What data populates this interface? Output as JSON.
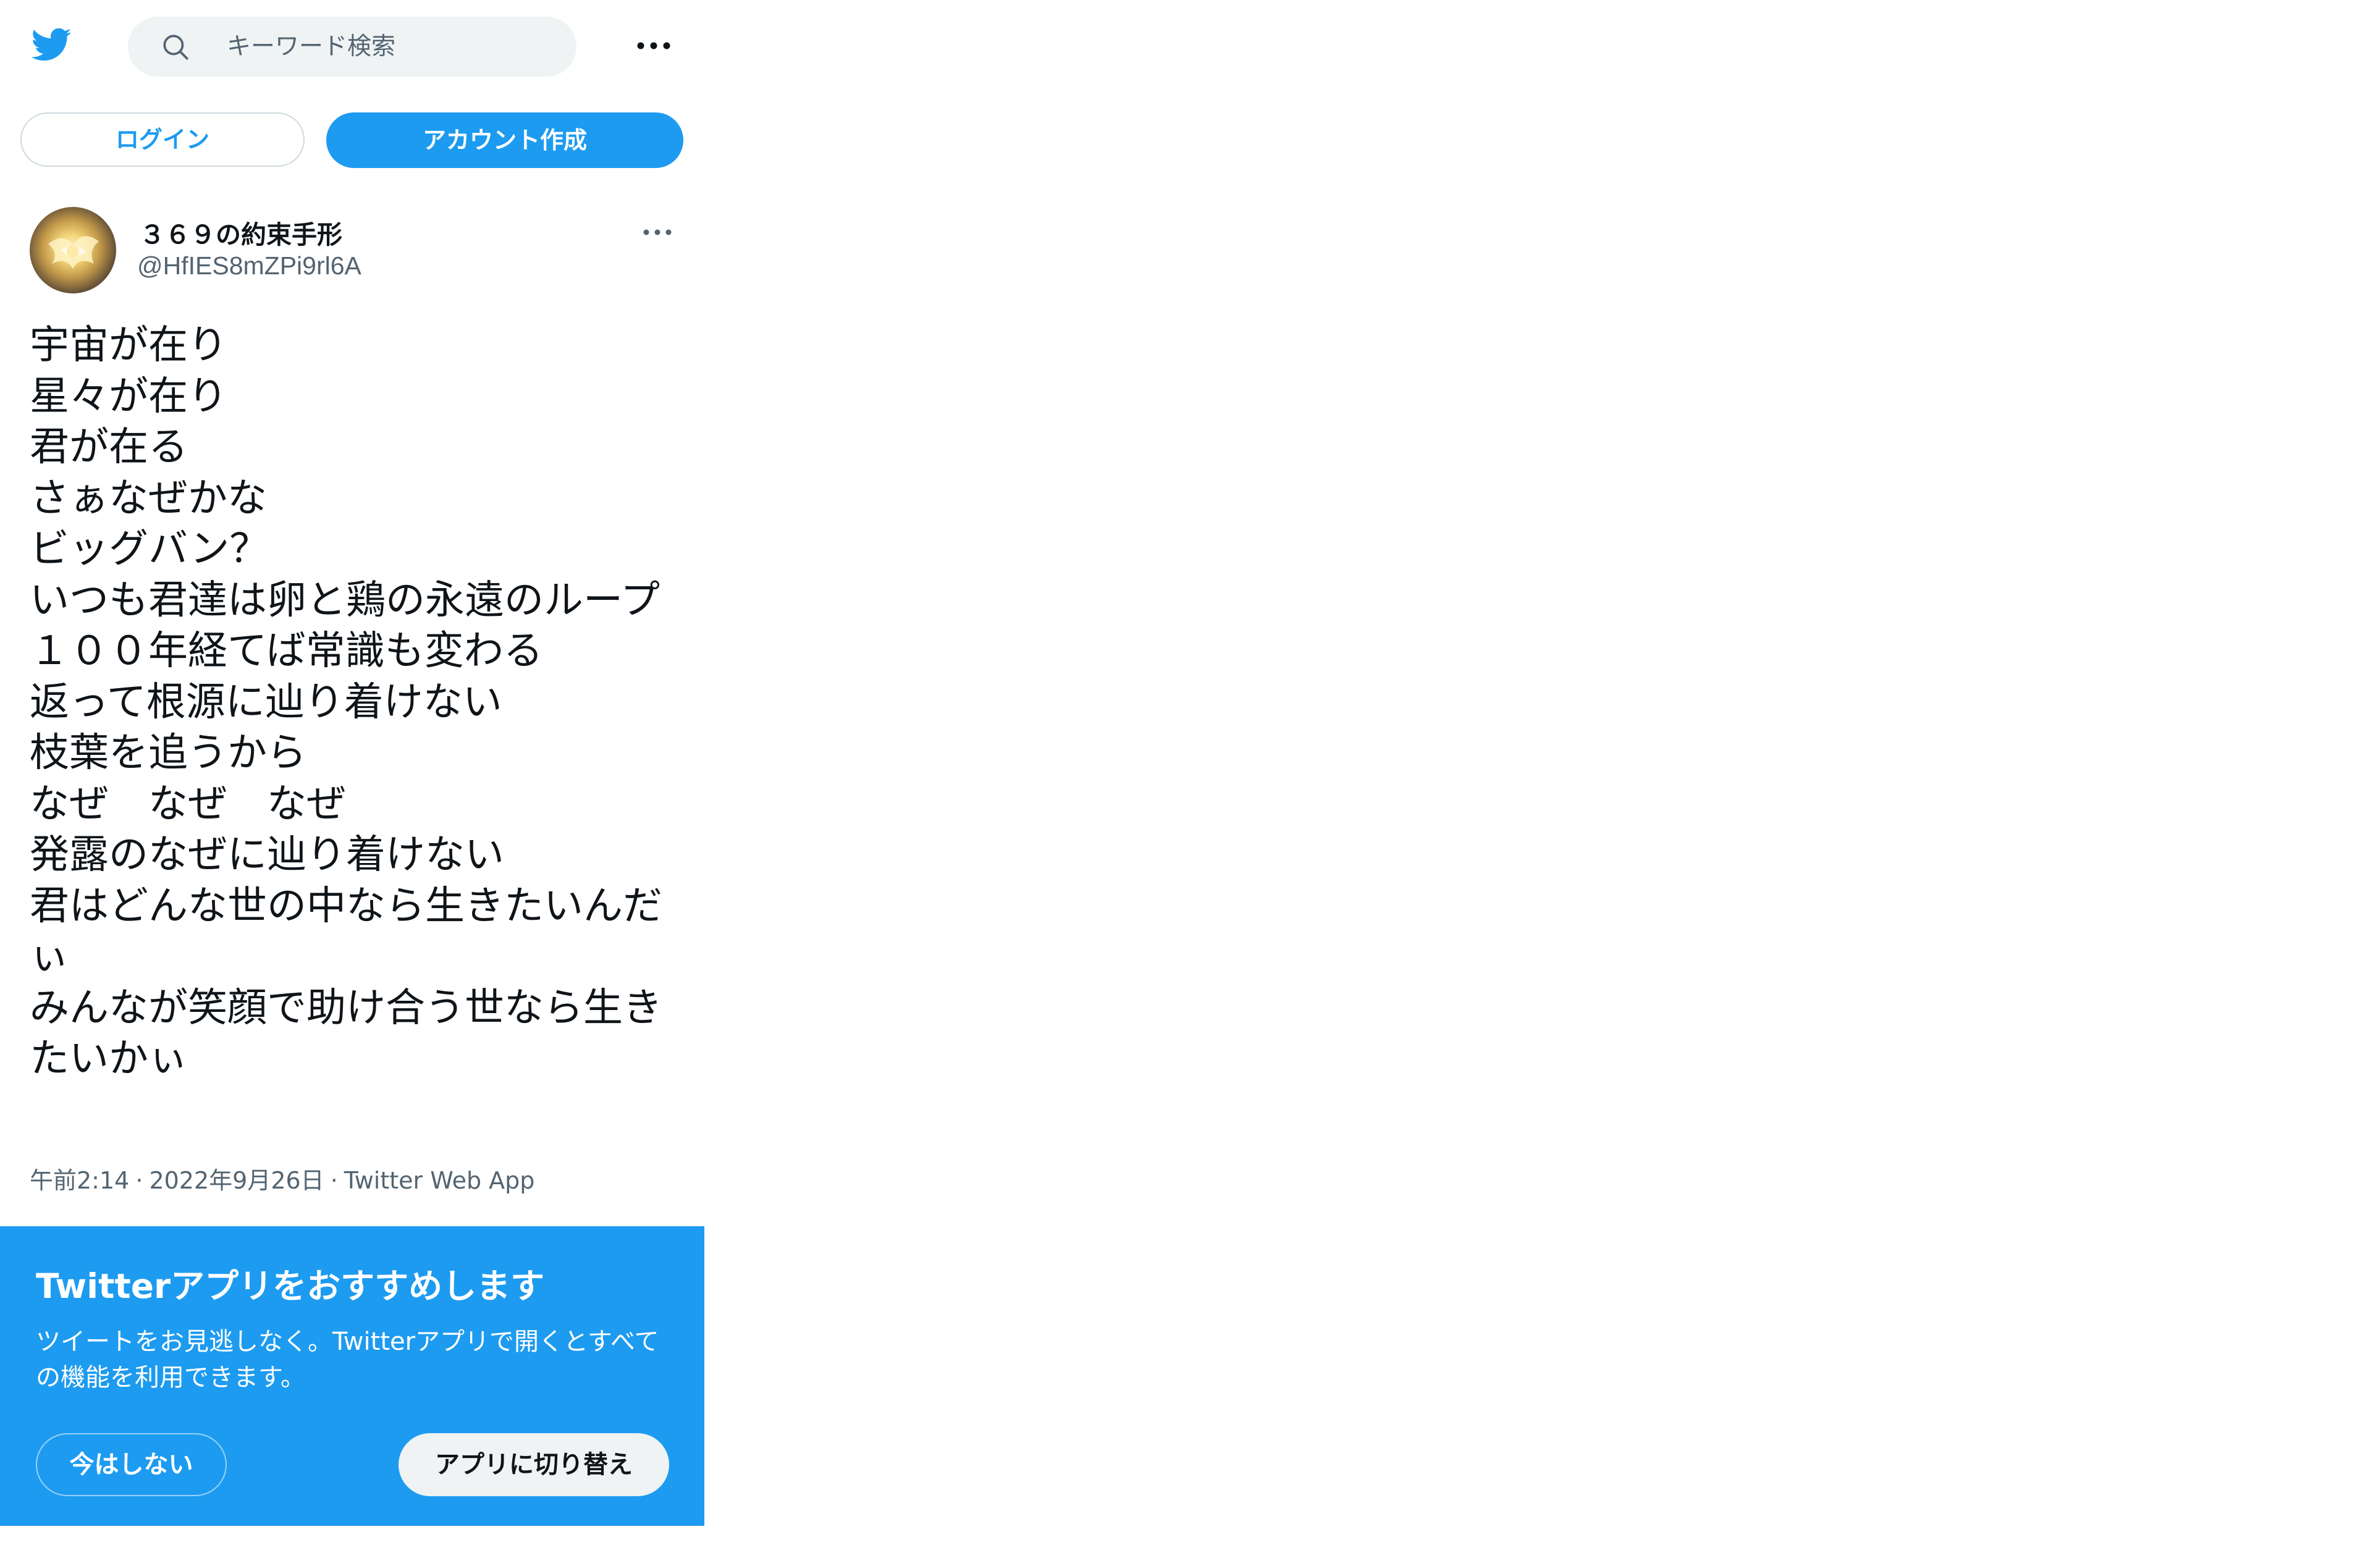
{
  "search": {
    "placeholder": "キーワード検索"
  },
  "auth": {
    "login_label": "ログイン",
    "signup_label": "アカウント作成"
  },
  "tweet": {
    "display_name": "３６９の約束手形",
    "handle": "@HfIES8mZPi9rl6A",
    "text": "宇宙が在り\n星々が在り\n君が在る\nさぁなぜかな\nビッグバン？\nいつも君達は卵と鶏の永遠のループ\n１００年経てば常識も変わる\n返って根源に辿り着けない\n枝葉を追うから\nなぜ　なぜ　なぜ\n発露のなぜに辿り着けない\n君はどんな世の中なら生きたいんだぃ\nみんなが笑顔で助け合う世なら生きたいかぃ",
    "time": "午前2:14",
    "date": "2022年9月26日",
    "source": "Twitter Web App",
    "separator": "·"
  },
  "app_banner": {
    "title": "Twitterアプリをおすすめします",
    "body": "ツイートをお見逃しなく。Twitterアプリで開くとすべての機能を利用できます。",
    "not_now_label": "今はしない",
    "switch_label": "アプリに切り替え"
  },
  "icons": {
    "logo": "twitter-bird-icon",
    "search": "search-icon",
    "more_top": "more-horizontal-icon",
    "more_tweet": "more-horizontal-icon"
  },
  "colors": {
    "brand": "#1d9bf0",
    "text": "#0f1419",
    "secondary_text": "#536471",
    "search_bg": "#eff3f4",
    "button_border": "#cfd9de"
  }
}
